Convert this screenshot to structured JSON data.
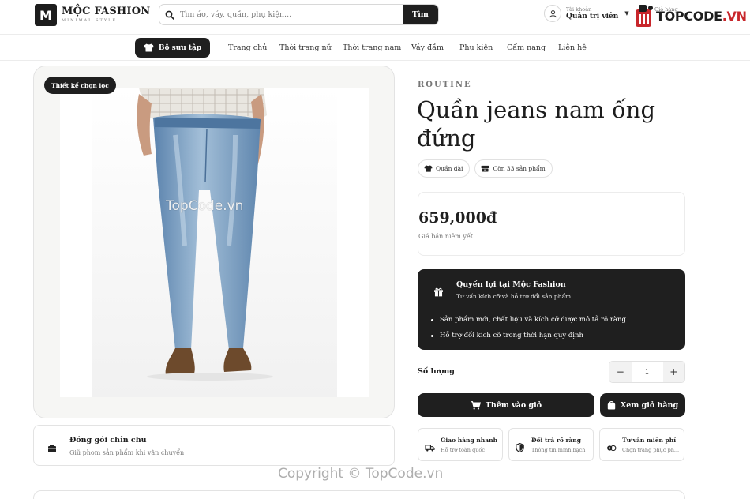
{
  "header": {
    "logo_letter": "M",
    "logo_name": "MỘC FASHION",
    "logo_tagline": "MINIMAL STYLE",
    "search_placeholder": "Tìm áo, váy, quần, phụ kiện...",
    "search_button": "Tìm",
    "account_label": "Tài khoản",
    "account_name": "Quản trị viên",
    "cart_label": "Giỏ hàng",
    "watermark_brand": "TOPCODE",
    "watermark_tld": ".VN"
  },
  "nav": {
    "featured": "Bộ sưu tập",
    "links": [
      "Trang chủ",
      "Thời trang nữ",
      "Thời trang nam",
      "Váy đầm",
      "Phụ kiện",
      "Cẩm nang",
      "Liên hệ"
    ]
  },
  "gallery": {
    "badge": "Thiết kế chọn lọc",
    "watermark": "TopCode.vn"
  },
  "packaging": {
    "title": "Đóng gói chỉn chu",
    "subtitle": "Giữ phom sản phẩm khi vận chuyển"
  },
  "product": {
    "brand": "ROUTINE",
    "title": "Quần jeans nam ống đứng",
    "tags": [
      "Quần dài",
      "Còn 33 sản phẩm"
    ],
    "price": "659,000đ",
    "price_note": "Giá bán niêm yết"
  },
  "benefits": {
    "title": "Quyền lợi tại Mộc Fashion",
    "subtitle": "Tư vấn kích cỡ và hỗ trợ đổi sản phẩm",
    "items": [
      "Sản phẩm mới, chất liệu và kích cỡ được mô tả rõ ràng",
      "Hỗ trợ đổi kích cỡ trong thời hạn quy định"
    ]
  },
  "purchase": {
    "quantity_label": "Số lượng",
    "quantity_value": "1",
    "minus": "−",
    "plus": "+",
    "add_to_cart": "Thêm vào giỏ",
    "view_cart": "Xem giỏ hàng"
  },
  "features": [
    {
      "title": "Giao hàng nhanh",
      "subtitle": "Hỗ trợ toàn quốc"
    },
    {
      "title": "Đổi trả rõ ràng",
      "subtitle": "Thông tin minh bạch"
    },
    {
      "title": "Tư vấn miễn phí",
      "subtitle": "Chọn trang phục ph..."
    }
  ],
  "footer_watermark": "Copyright © TopCode.vn",
  "colors": {
    "primary": "#1f1f1f",
    "accent": "#c8262b",
    "border": "#e3e3e3",
    "muted": "#777777"
  }
}
